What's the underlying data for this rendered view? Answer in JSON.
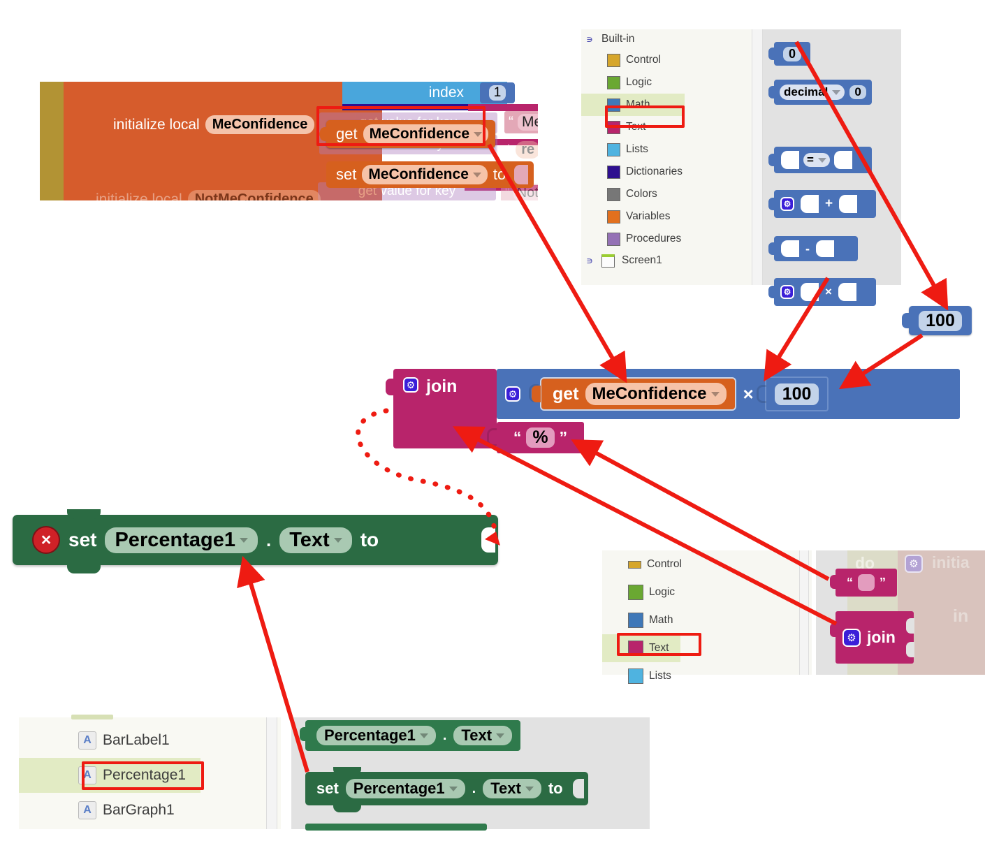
{
  "workspace_top": {
    "list_index_label": "index",
    "list_index_value": "1",
    "init_local_label": "initialize local",
    "init_local_var": "MeConfidence",
    "init_local_var2": "NotMeConfidence",
    "init_local_label2": "initialize local",
    "to_word": "to",
    "get_value_for_key": "get value for key",
    "in_dictionary": "in dictionary",
    "get_word": "get",
    "get_var": "MeConfidence",
    "set_word": "set",
    "set_var": "MeConfidence",
    "set_to": "to",
    "text_me": "Me",
    "text_not": "Not",
    "get_re": "re"
  },
  "palette_top": {
    "root_label": "Built-in",
    "screen_label": "Screen1",
    "highlighted": "Math",
    "items": [
      {
        "label": "Control",
        "color": "#d6a62b"
      },
      {
        "label": "Logic",
        "color": "#6aa832"
      },
      {
        "label": "Math",
        "color": "#3f78b8"
      },
      {
        "label": "Text",
        "color": "#b8246b"
      },
      {
        "label": "Lists",
        "color": "#4fb3e0"
      },
      {
        "label": "Dictionaries",
        "color": "#2e0f8f"
      },
      {
        "label": "Colors",
        "color": "#777777"
      },
      {
        "label": "Variables",
        "color": "#e2701e"
      },
      {
        "label": "Procedures",
        "color": "#9471b5"
      }
    ]
  },
  "math_flyout": {
    "number_zero": "0",
    "decimal_label": "decimal",
    "decimal_value": "0",
    "compare_op": "=",
    "plus_op": "+",
    "minus_op": "-",
    "times_op": "×"
  },
  "number_block": {
    "value": "100"
  },
  "join_block": {
    "join_label": "join",
    "times_symbol": "×",
    "get_word": "get",
    "get_var": "MeConfidence",
    "multiplier": "100",
    "percent_text": "%",
    "open_quote": "“",
    "close_quote": "”"
  },
  "set_percentage_block": {
    "error_icon": "×",
    "set_word": "set",
    "component": "Percentage1",
    "property": "Text",
    "to_word": "to"
  },
  "palette_bottom": {
    "highlighted": "Text",
    "items": [
      {
        "label": "Control",
        "color": "#d6a62b"
      },
      {
        "label": "Logic",
        "color": "#6aa832"
      },
      {
        "label": "Math",
        "color": "#3f78b8"
      },
      {
        "label": "Text",
        "color": "#b8246b"
      },
      {
        "label": "Lists",
        "color": "#4fb3e0"
      }
    ]
  },
  "text_flyout": {
    "empty_string_open_quote": "“",
    "empty_string_close_quote": "”",
    "join_label": "join",
    "bg_do_word": "do",
    "bg_initialize_word": "initia",
    "bg_in_word": "in"
  },
  "component_tree": {
    "highlighted": "Percentage1",
    "items": [
      {
        "label": "BarLabel1",
        "icon": "A"
      },
      {
        "label": "Percentage1",
        "icon": "A"
      },
      {
        "label": "BarGraph1",
        "icon": "A"
      }
    ]
  },
  "percentage_flyout": {
    "getter_component": "Percentage1",
    "getter_property": "Text",
    "setter_set_word": "set",
    "setter_component": "Percentage1",
    "setter_property": "Text",
    "setter_to_word": "to"
  },
  "colors": {
    "annotation_red": "#ee1b12",
    "variables_orange": "#d6601e",
    "text_magenta": "#b8246b",
    "math_blue": "#4a72b8",
    "component_green": "#2b6b43",
    "highlight_green": "#e2ebc4"
  }
}
